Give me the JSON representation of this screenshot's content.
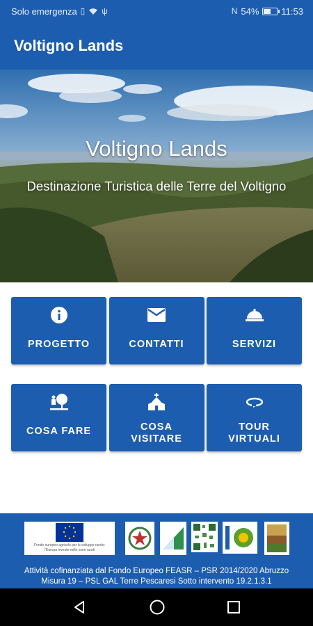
{
  "status_bar": {
    "carrier": "Solo emergenza",
    "battery": "54%",
    "battery_level": 0.54,
    "time": "11:53"
  },
  "app_bar": {
    "title": "Voltigno Lands"
  },
  "hero": {
    "title": "Voltigno Lands",
    "subtitle": "Destinazione Turistica delle Terre del Voltigno"
  },
  "tiles": [
    {
      "label": "PROGETTO",
      "icon": "info-icon"
    },
    {
      "label": "CONTATTI",
      "icon": "mail-icon"
    },
    {
      "label": "SERVIZI",
      "icon": "room-service-bell-icon"
    },
    {
      "label": "COSA FARE",
      "icon": "nature-people-icon"
    },
    {
      "label": "COSA VISITARE",
      "icon": "church-icon"
    },
    {
      "label": "TOUR VIRTUALI",
      "icon": "rotate-360-icon"
    }
  ],
  "footer": {
    "eu_caption_1": "Fondo europeo agricolo per lo sviluppo rurale:",
    "eu_caption_2": "l'Europa investe nelle zone rurali",
    "line1": "Attività cofinanziata dal Fondo Europeo FEASR – PSR 2014/2020 Abruzzo",
    "line2": "Misura 19 – PSL GAL Terre Pescaresi Sotto intervento 19.2.1.3.1"
  },
  "nav": {
    "back": "back-icon",
    "home": "home-icon",
    "recents": "recents-icon"
  },
  "colors": {
    "primary": "#1c5db0",
    "nav_bg": "#000000",
    "text_on_primary": "#ffffff"
  }
}
